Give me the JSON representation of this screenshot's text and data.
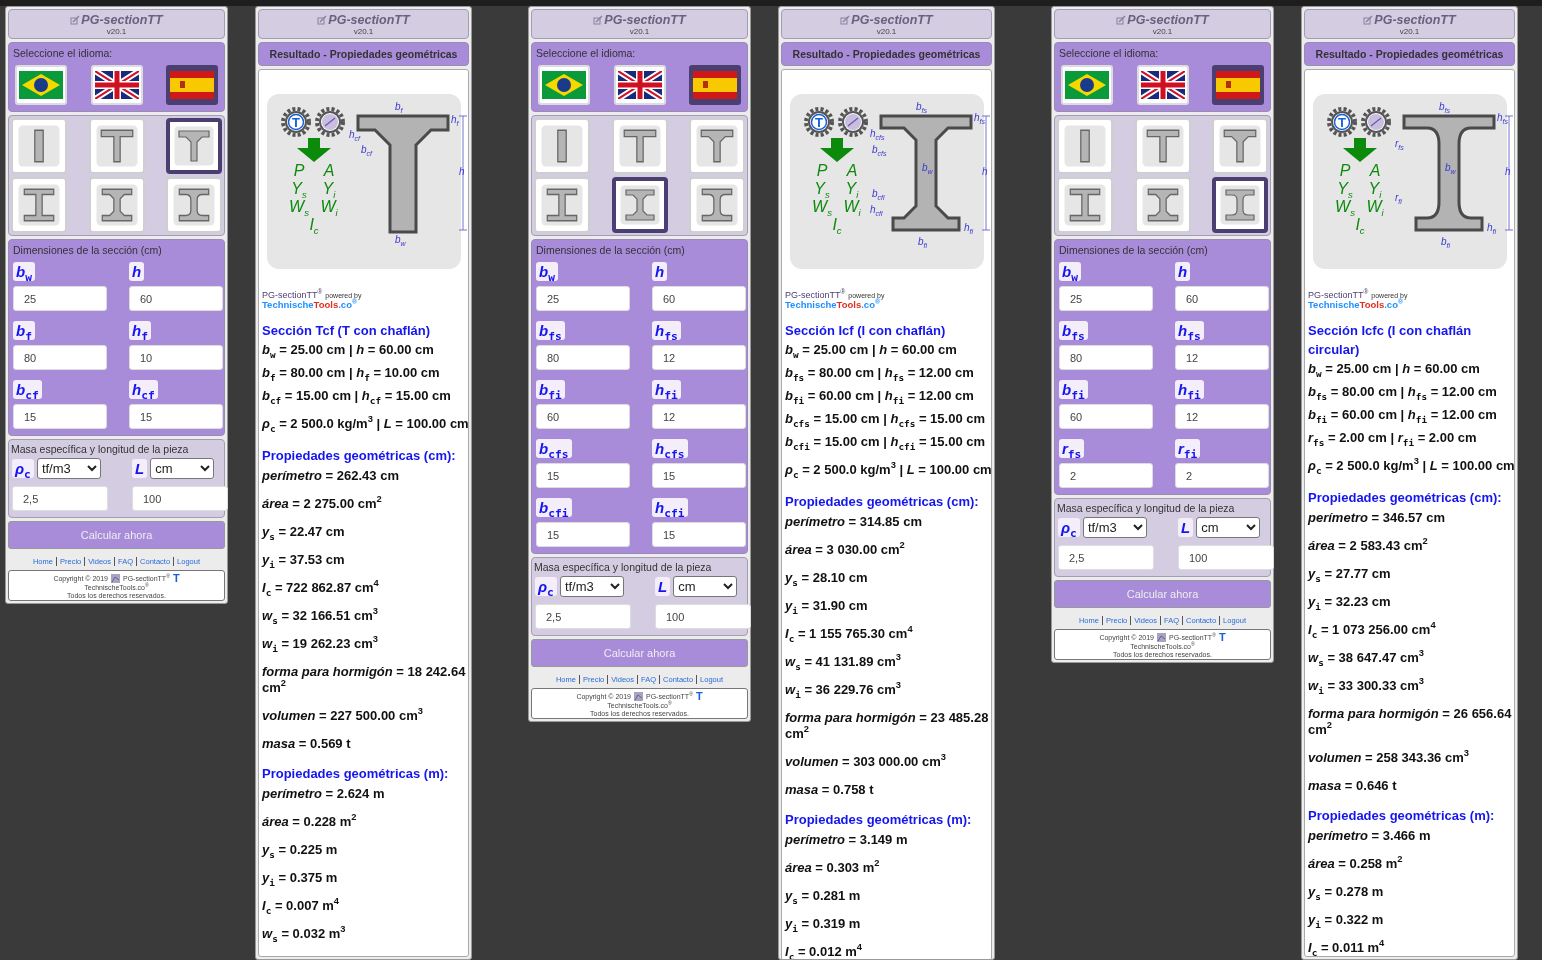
{
  "screens": [
    {
      "input": {
        "app_title": "PG-sectionTT",
        "version": "v20.1",
        "language_label": "Seleccione el idioma:",
        "languages": [
          {
            "kind": "brazil",
            "selected": false
          },
          {
            "kind": "uk",
            "selected": false
          },
          {
            "kind": "spain",
            "selected": true
          }
        ],
        "sections": [
          {
            "kind": "rect",
            "selected": false
          },
          {
            "kind": "tee",
            "selected": false
          },
          {
            "kind": "tee_chamfer",
            "selected": true
          },
          {
            "kind": "i",
            "selected": false
          },
          {
            "kind": "i_chamfer",
            "selected": false
          },
          {
            "kind": "i_round",
            "selected": false
          }
        ],
        "dims_title": "Dimensiones de la sección (cm)",
        "dims": [
          {
            "label": "b$_{w}$",
            "value": "25"
          },
          {
            "label": "h",
            "value": "60"
          },
          {
            "label": "b$_{f}$",
            "value": "80"
          },
          {
            "label": "h$_{f}$",
            "value": "10"
          },
          {
            "label": "b$_{cf}$",
            "value": "15"
          },
          {
            "label": "h$_{cf}$",
            "value": "15"
          }
        ],
        "mass_title": "Masa específica y longitud de la pieza",
        "mass": [
          {
            "label": "ρ$_{c}$",
            "unit": "tf/m3",
            "value": "2,5"
          },
          {
            "label": "L",
            "unit": "cm",
            "value": "100"
          }
        ],
        "button": "Calcular ahora",
        "links": [
          "Home",
          "Precio",
          "Videos",
          "FAQ",
          "Contacto",
          "Logout"
        ],
        "copyright": {
          "line1": "Copyright © 2019",
          "product": "PG-sectionTT$^{®}$",
          "logo_letter": "T",
          "line2": "TechnischeTools.co$^{®}$",
          "line3": "Todos los derechos reservados."
        }
      },
      "result": {
        "app_title": "PG-sectionTT",
        "version": "v20.1",
        "header": "Resultado - Propiedades geométricas",
        "diagram": {
          "kind": "tee_chamfer",
          "gear_letter": "T",
          "letters": [
            "P",
            "A",
            "Y$_{s}$",
            "Y$_{i}$",
            "W$_{s}$",
            "W$_{i}$",
            "I$_{c}$"
          ],
          "labels": [
            "b$_{f}$",
            "h$_{f}$",
            "h$_{cf}$",
            "b$_{cf}$",
            "h",
            "b$_{w}$"
          ]
        },
        "brand": {
          "name": "PG-sectionTT$^{®}$",
          "powered": "powered by",
          "parts": [
            {
              "text": "Technische",
              "color": "#1e90ff"
            },
            {
              "text": "Tools",
              "color": "#e03020"
            },
            {
              "text": ".co$^{®}$",
              "color": "#1e90ff"
            }
          ]
        },
        "section_title": "Sección Tcf (T con chaflán)",
        "input_lines": [
          "*b*$_{w}$ = 25.00 cm | *h* = 60.00 cm",
          "*b*$_{f}$ = 80.00 cm | *h*$_{f}$ = 10.00 cm",
          "*b*$_{cf}$ = 15.00 cm | *h*$_{cf}$ = 15.00 cm",
          "*ρ*$_{c}$ = 2 500.0 kg/m$^{3}$ | *L* = 100.00 cm"
        ],
        "props_cm_title": "Propiedades geométricas (cm):",
        "props_cm": [
          "*perímetro* = 262.43 cm",
          "*área* = 2 275.00 cm$^{2}$",
          "*y*$_{s}$ = 22.47 cm",
          "*y*$_{i}$ = 37.53 cm",
          "*I*$_{c}$ = 722 862.87 cm$^{4}$",
          "*w*$_{s}$ = 32 166.51 cm$^{3}$",
          "*w*$_{i}$ = 19 262.23 cm$^{3}$",
          "*forma para hormigón* = 18 242.64 cm$^{2}$",
          "*volumen* = 227 500.00 cm$^{3}$",
          "*masa* = 0.569 t"
        ],
        "props_m_title": "Propiedades geométricas (m):",
        "props_m": [
          "*perímetro* = 2.624 m",
          "*área* = 0.228 m$^{2}$",
          "*y*$_{s}$ = 0.225 m",
          "*y*$_{i}$ = 0.375 m",
          "*I*$_{c}$ = 0.007 m$^{4}$",
          "*w*$_{s}$ = 0.032 m$^{3}$"
        ]
      }
    },
    {
      "input": {
        "app_title": "PG-sectionTT",
        "version": "v20.1",
        "language_label": "Seleccione el idioma:",
        "languages": [
          {
            "kind": "brazil",
            "selected": false
          },
          {
            "kind": "uk",
            "selected": false
          },
          {
            "kind": "spain",
            "selected": true
          }
        ],
        "sections": [
          {
            "kind": "rect",
            "selected": false
          },
          {
            "kind": "tee",
            "selected": false
          },
          {
            "kind": "tee_chamfer",
            "selected": false
          },
          {
            "kind": "i",
            "selected": false
          },
          {
            "kind": "i_chamfer",
            "selected": true
          },
          {
            "kind": "i_round",
            "selected": false
          }
        ],
        "dims_title": "Dimensiones de la sección (cm)",
        "dims": [
          {
            "label": "b$_{w}$",
            "value": "25"
          },
          {
            "label": "h",
            "value": "60"
          },
          {
            "label": "b$_{fs}$",
            "value": "80"
          },
          {
            "label": "h$_{fs}$",
            "value": "12"
          },
          {
            "label": "b$_{fi}$",
            "value": "60"
          },
          {
            "label": "h$_{fi}$",
            "value": "12"
          },
          {
            "label": "b$_{cfs}$",
            "value": "15"
          },
          {
            "label": "h$_{cfs}$",
            "value": "15"
          },
          {
            "label": "b$_{cfi}$",
            "value": "15"
          },
          {
            "label": "h$_{cfi}$",
            "value": "15"
          }
        ],
        "mass_title": "Masa específica y longitud de la pieza",
        "mass": [
          {
            "label": "ρ$_{c}$",
            "unit": "tf/m3",
            "value": "2,5"
          },
          {
            "label": "L",
            "unit": "cm",
            "value": "100"
          }
        ],
        "button": "Calcular ahora",
        "links": [
          "Home",
          "Precio",
          "Videos",
          "FAQ",
          "Contacto",
          "Logout"
        ],
        "copyright": {
          "line1": "Copyright © 2019",
          "product": "PG-sectionTT$^{®}$",
          "logo_letter": "T",
          "line2": "TechnischeTools.co$^{®}$",
          "line3": "Todos los derechos reservados."
        }
      },
      "result": {
        "app_title": "PG-sectionTT",
        "version": "v20.1",
        "header": "Resultado - Propiedades geométricas",
        "diagram": {
          "kind": "i_chamfer",
          "gear_letter": "T",
          "letters": [
            "P",
            "A",
            "Y$_{s}$",
            "Y$_{i}$",
            "W$_{s}$",
            "W$_{i}$",
            "I$_{c}$"
          ],
          "labels": [
            "b$_{fs}$",
            "h$_{fs}$",
            "h$_{cfs}$",
            "b$_{cfs}$",
            "b$_{w}$",
            "h",
            "b$_{cfi}$",
            "h$_{cfi}$",
            "h$_{fi}$",
            "b$_{fi}$"
          ]
        },
        "brand": {
          "name": "PG-sectionTT$^{®}$",
          "powered": "powered by",
          "parts": [
            {
              "text": "Technische",
              "color": "#1e90ff"
            },
            {
              "text": "Tools",
              "color": "#e03020"
            },
            {
              "text": ".co$^{®}$",
              "color": "#1e90ff"
            }
          ]
        },
        "section_title": "Sección Icf (I con chaflán)",
        "input_lines": [
          "*b*$_{w}$ = 25.00 cm | *h* = 60.00 cm",
          "*b*$_{fs}$ = 80.00 cm | *h*$_{fs}$ = 12.00 cm",
          "*b*$_{fi}$ = 60.00 cm | *h*$_{fi}$ = 12.00 cm",
          "*b*$_{cfs}$ = 15.00 cm | *h*$_{cfs}$ = 15.00 cm",
          "*b*$_{cfi}$ = 15.00 cm | *h*$_{cfi}$ = 15.00 cm",
          "*ρ*$_{c}$ = 2 500.0 kg/m$^{3}$ | *L* = 100.00 cm"
        ],
        "props_cm_title": "Propiedades geométricas (cm):",
        "props_cm": [
          "*perímetro* = 314.85 cm",
          "*área* = 3 030.00 cm$^{2}$",
          "*y*$_{s}$ = 28.10 cm",
          "*y*$_{i}$ = 31.90 cm",
          "*I*$_{c}$ = 1 155 765.30 cm$^{4}$",
          "*w*$_{s}$ = 41 131.89 cm$^{3}$",
          "*w*$_{i}$ = 36 229.76 cm$^{3}$",
          "*forma para hormigón* = 23 485.28 cm$^{2}$",
          "*volumen* = 303 000.00 cm$^{3}$",
          "*masa* = 0.758 t"
        ],
        "props_m_title": "Propiedades geométricas (m):",
        "props_m": [
          "*perímetro* = 3.149 m",
          "*área* = 0.303 m$^{2}$",
          "*y*$_{s}$ = 0.281 m",
          "*y*$_{i}$ = 0.319 m",
          "*I*$_{c}$ = 0.012 m$^{4}$"
        ]
      }
    },
    {
      "input": {
        "app_title": "PG-sectionTT",
        "version": "v20.1",
        "language_label": "Seleccione el idioma:",
        "languages": [
          {
            "kind": "brazil",
            "selected": false
          },
          {
            "kind": "uk",
            "selected": false
          },
          {
            "kind": "spain",
            "selected": true
          }
        ],
        "sections": [
          {
            "kind": "rect",
            "selected": false
          },
          {
            "kind": "tee",
            "selected": false
          },
          {
            "kind": "tee_chamfer",
            "selected": false
          },
          {
            "kind": "i",
            "selected": false
          },
          {
            "kind": "i_chamfer",
            "selected": false
          },
          {
            "kind": "i_round",
            "selected": true
          }
        ],
        "dims_title": "Dimensiones de la sección (cm)",
        "dims": [
          {
            "label": "b$_{w}$",
            "value": "25"
          },
          {
            "label": "h",
            "value": "60"
          },
          {
            "label": "b$_{fs}$",
            "value": "80"
          },
          {
            "label": "h$_{fs}$",
            "value": "12"
          },
          {
            "label": "b$_{fi}$",
            "value": "60"
          },
          {
            "label": "h$_{fi}$",
            "value": "12"
          },
          {
            "label": "r$_{fs}$",
            "value": "2"
          },
          {
            "label": "r$_{fi}$",
            "value": "2"
          }
        ],
        "mass_title": "Masa específica y longitud de la pieza",
        "mass": [
          {
            "label": "ρ$_{c}$",
            "unit": "tf/m3",
            "value": "2,5"
          },
          {
            "label": "L",
            "unit": "cm",
            "value": "100"
          }
        ],
        "button": "Calcular ahora",
        "links": [
          "Home",
          "Precio",
          "Videos",
          "FAQ",
          "Contacto",
          "Logout"
        ],
        "copyright": {
          "line1": "Copyright © 2019",
          "product": "PG-sectionTT$^{®}$",
          "logo_letter": "T",
          "line2": "TechnischeTools.co$^{®}$",
          "line3": "Todos los derechos reservados."
        }
      },
      "result": {
        "app_title": "PG-sectionTT",
        "version": "v20.1",
        "header": "Resultado - Propiedades geométricas",
        "diagram": {
          "kind": "i_round",
          "gear_letter": "T",
          "letters": [
            "P",
            "A",
            "Y$_{s}$",
            "Y$_{i}$",
            "W$_{s}$",
            "W$_{i}$",
            "I$_{c}$"
          ],
          "labels": [
            "b$_{fs}$",
            "h$_{fs}$",
            "r$_{fs}$",
            "b$_{w}$",
            "h",
            "r$_{fi}$",
            "h$_{fi}$",
            "b$_{fi}$"
          ]
        },
        "brand": {
          "name": "PG-sectionTT$^{®}$",
          "powered": "powered by",
          "parts": [
            {
              "text": "Technische",
              "color": "#1e90ff"
            },
            {
              "text": "Tools",
              "color": "#e03020"
            },
            {
              "text": ".co$^{®}$",
              "color": "#1e90ff"
            }
          ]
        },
        "section_title": "Sección Icfc (I con chaflán circular)",
        "input_lines": [
          "*b*$_{w}$ = 25.00 cm | *h* = 60.00 cm",
          "*b*$_{fs}$ = 80.00 cm | *h*$_{fs}$ = 12.00 cm",
          "*b*$_{fi}$ = 60.00 cm | *h*$_{fi}$ = 12.00 cm",
          "*r*$_{fs}$ = 2.00 cm | *r*$_{fi}$ = 2.00 cm",
          "*ρ*$_{c}$ = 2 500.0 kg/m$^{3}$ | *L* = 100.00 cm"
        ],
        "props_cm_title": "Propiedades geométricas (cm):",
        "props_cm": [
          "*perímetro* = 346.57 cm",
          "*área* = 2 583.43 cm$^{2}$",
          "*y*$_{s}$ = 27.77 cm",
          "*y*$_{i}$ = 32.23 cm",
          "*I*$_{c}$ = 1 073 256.00 cm$^{4}$",
          "*w*$_{s}$ = 38 647.47 cm$^{3}$",
          "*w*$_{i}$ = 33 300.33 cm$^{3}$",
          "*forma para hormigón* = 26 656.64 cm$^{2}$",
          "*volumen* = 258 343.36 cm$^{3}$",
          "*masa* = 0.646 t"
        ],
        "props_m_title": "Propiedades geométricas (m):",
        "props_m": [
          "*perímetro* = 3.466 m",
          "*área* = 0.258 m$^{2}$",
          "*y*$_{s}$ = 0.278 m",
          "*y*$_{i}$ = 0.322 m",
          "*I*$_{c}$ = 0.011 m$^{4}$"
        ]
      }
    }
  ]
}
